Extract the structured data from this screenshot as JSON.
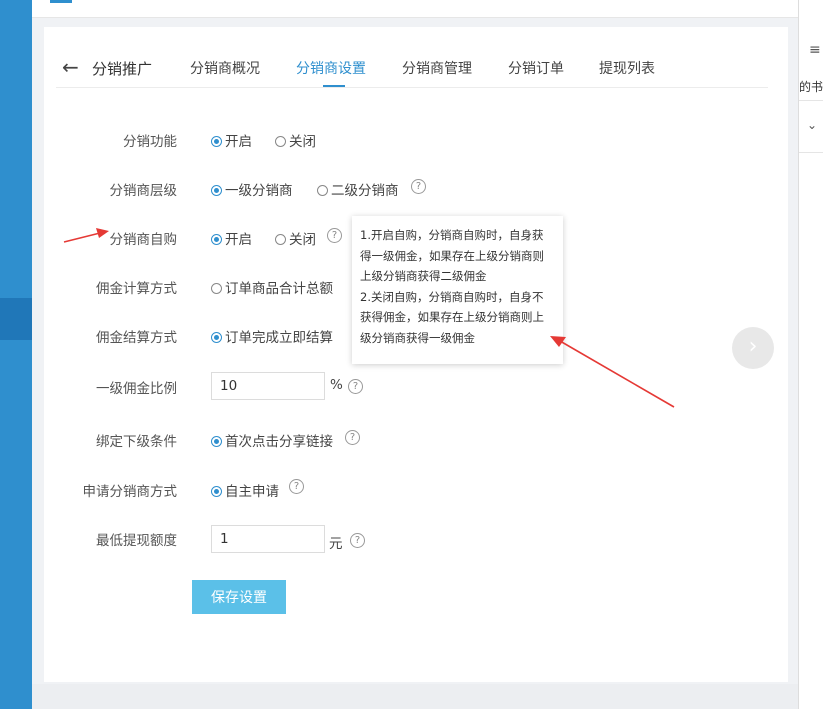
{
  "header": {
    "back_icon": "arrow-left-icon",
    "title": "分销推广",
    "tabs": [
      "分销商概况",
      "分销商设置",
      "分销商管理",
      "分销订单",
      "提现列表"
    ],
    "active_tab": "分销商设置"
  },
  "form": {
    "distribution": {
      "label": "分销功能",
      "options": [
        "开启",
        "关闭"
      ],
      "selected": "开启"
    },
    "level": {
      "label": "分销商层级",
      "options": [
        "一级分销商",
        "二级分销商"
      ],
      "selected": "一级分销商"
    },
    "self_purchase": {
      "label": "分销商自购",
      "options": [
        "开启",
        "关闭"
      ],
      "selected": "开启"
    },
    "commission_calc": {
      "label": "佣金计算方式",
      "options": [
        "订单商品合计总额"
      ],
      "selected": ""
    },
    "commission_settle": {
      "label": "佣金结算方式",
      "options": [
        "订单完成立即结算"
      ],
      "selected": "订单完成立即结算"
    },
    "first_level_ratio": {
      "label": "一级佣金比例",
      "value": "10",
      "unit": "%"
    },
    "bind_condition": {
      "label": "绑定下级条件",
      "options": [
        "首次点击分享链接"
      ],
      "selected": "首次点击分享链接"
    },
    "apply_method": {
      "label": "申请分销商方式",
      "options": [
        "自主申请"
      ],
      "selected": "自主申请"
    },
    "min_withdraw": {
      "label": "最低提现额度",
      "value": "1",
      "unit": "元"
    },
    "save_label": "保存设置"
  },
  "tooltip": {
    "lines": [
      "1.开启自购，分销商自购时，自身获",
      "得一级佣金，如果存在上级分销商则",
      "上级分销商获得二级佣金",
      "2.关闭自购，分销商自购时，自身不",
      "获得佣金，如果存在上级分销商则上",
      "级分销商获得一级佣金"
    ]
  },
  "right_panel": {
    "text": "的书签"
  },
  "colors": {
    "accent": "#2f8fce",
    "save_button": "#5bc0e8",
    "sidebar": "#2f8fce",
    "arrow": "#e53935"
  }
}
